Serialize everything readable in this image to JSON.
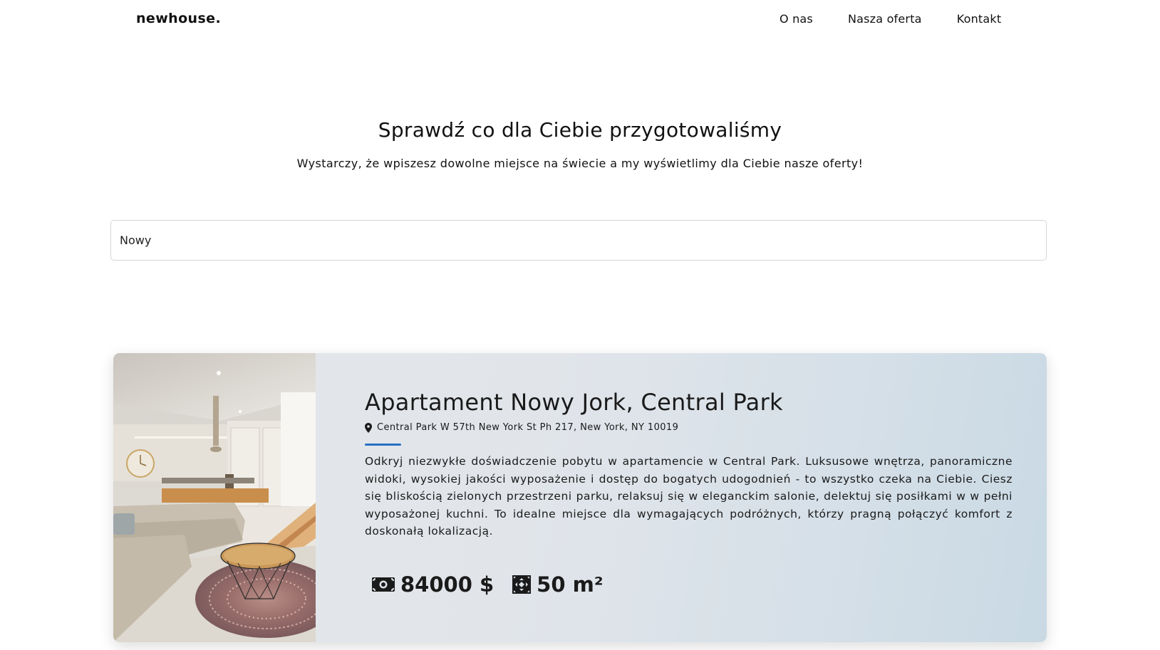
{
  "navbar": {
    "brand": "newhouse.",
    "links": [
      "O nas",
      "Nasza oferta",
      "Kontakt"
    ]
  },
  "hero": {
    "title": "Sprawdź co dla Ciebie przygotowaliśmy",
    "subtitle": "Wystarczy, że wpiszesz dowolne miejsce na świecie a my wyświetlimy dla Ciebie nasze oferty!"
  },
  "search": {
    "value": "Nowy"
  },
  "listing": {
    "title": "Apartament Nowy Jork, Central Park",
    "address": "Central Park W 57th New York St Ph 217, New York, NY 10019",
    "description": "Odkryj niezwykłe doświadczenie pobytu w apartamencie w Central Park. Luksusowe wnętrza, panoramiczne widoki, wysokiej jakości wyposażenie i dostęp do bogatych udogodnień - to wszystko czeka na Ciebie. Ciesz się bliskością zielonych przestrzeni parku, relaksuj się w eleganckim salonie, delektuj się posiłkami w w pełni wyposażonej kuchni. To idealne miejsce dla wymagających podróżnych, którzy pragną połączyć komfort z doskonałą lokalizacją.",
    "price": "84000 $",
    "area": "50 m²",
    "icons": {
      "address": "map-pin-icon",
      "price": "money-bill-icon",
      "area": "expand-arrows-icon"
    },
    "accent_color": "#2470c4"
  }
}
